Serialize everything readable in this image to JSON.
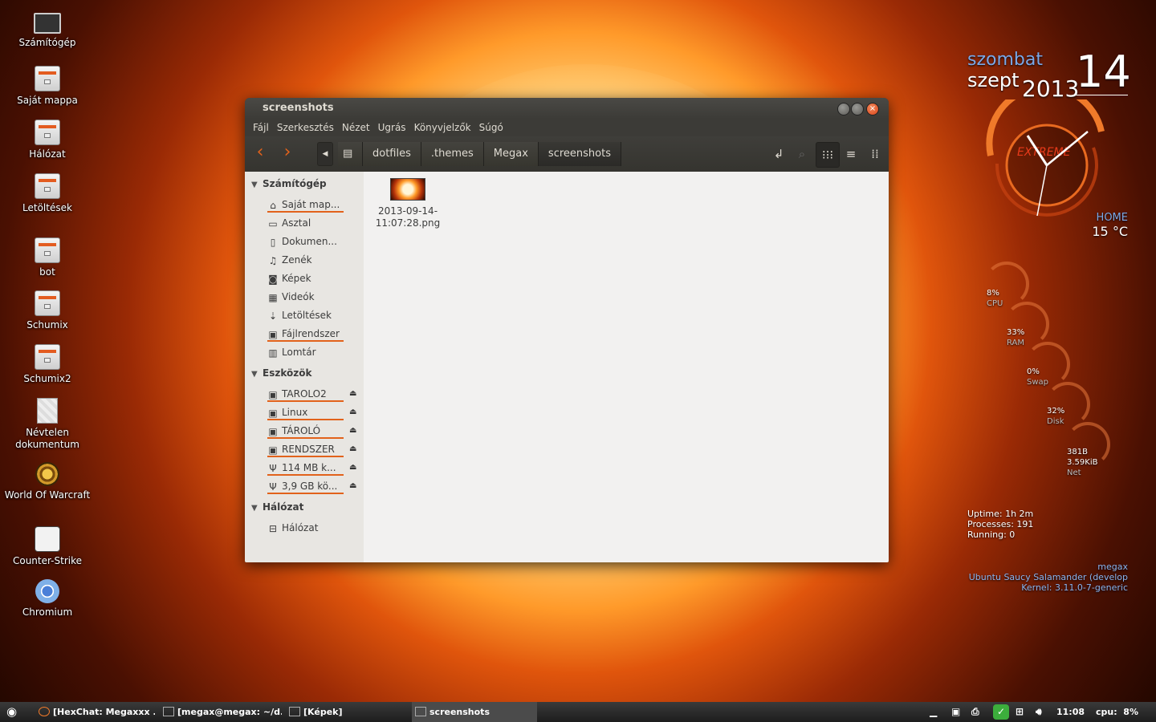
{
  "desktop": {
    "icons": [
      {
        "label": "Számítógép",
        "icon": "computer-icon"
      },
      {
        "label": "Saját mappa",
        "icon": "home-folder-icon"
      },
      {
        "label": "Hálózat",
        "icon": "network-folder-icon"
      },
      {
        "label": "Letöltések",
        "icon": "downloads-folder-icon"
      },
      {
        "label": "bot",
        "icon": "folder-icon"
      },
      {
        "label": "Schumix",
        "icon": "folder-icon"
      },
      {
        "label": "Schumix2",
        "icon": "folder-icon"
      },
      {
        "label": "Névtelen dokumentum",
        "icon": "document-icon"
      },
      {
        "label": "World Of Warcraft",
        "icon": "wow-icon"
      },
      {
        "label": "Counter-Strike",
        "icon": "counter-strike-icon"
      },
      {
        "label": "Chromium",
        "icon": "chromium-icon"
      }
    ]
  },
  "conky": {
    "day": "szombat",
    "month": "szept",
    "year": "2013",
    "date": "14",
    "location": "HOME",
    "temperature": "15 °C",
    "cpu": {
      "value": "8%",
      "label": "CPU"
    },
    "ram": {
      "value": "33%",
      "label": "RAM"
    },
    "swap": {
      "value": "0%",
      "label": "Swap"
    },
    "disk": {
      "value": "32%",
      "label": "Disk"
    },
    "net": {
      "up": "381B",
      "down": "3.59KiB",
      "label": "Net"
    },
    "uptime": "Uptime: 1h 2m",
    "processes": "Processes: 191",
    "running": "Running: 0",
    "user": "megax",
    "distro": "Ubuntu Saucy Salamander (develop",
    "kernel": "Kernel: 3.11.0-7-generic"
  },
  "window": {
    "title": "screenshots",
    "menu": [
      "Fájl",
      "Szerkesztés",
      "Nézet",
      "Ugrás",
      "Könyvjelzők",
      "Súgó"
    ],
    "breadcrumbs": [
      "dotfiles",
      ".themes",
      "Megax",
      "screenshots"
    ],
    "sidebar": {
      "computer_header": "Számítógép",
      "computer_items": [
        {
          "label": "Saját map...",
          "icon": "home-icon"
        },
        {
          "label": "Asztal",
          "icon": "desktop-icon"
        },
        {
          "label": "Dokumen...",
          "icon": "documents-icon"
        },
        {
          "label": "Zenék",
          "icon": "music-icon"
        },
        {
          "label": "Képek",
          "icon": "pictures-icon"
        },
        {
          "label": "Videók",
          "icon": "videos-icon"
        },
        {
          "label": "Letöltések",
          "icon": "downloads-icon"
        },
        {
          "label": "Fájlrendszer",
          "icon": "filesystem-icon"
        },
        {
          "label": "Lomtár",
          "icon": "trash-icon"
        }
      ],
      "devices_header": "Eszközök",
      "device_items": [
        {
          "label": "TAROLO2",
          "icon": "drive-icon"
        },
        {
          "label": "Linux",
          "icon": "drive-icon"
        },
        {
          "label": "TÁROLÓ",
          "icon": "drive-icon"
        },
        {
          "label": "RENDSZER",
          "icon": "drive-icon"
        },
        {
          "label": "114 MB k...",
          "icon": "usb-icon"
        },
        {
          "label": "3,9 GB kö...",
          "icon": "usb-icon"
        }
      ],
      "network_header": "Hálózat",
      "network_items": [
        {
          "label": "Hálózat",
          "icon": "network-icon"
        }
      ]
    },
    "files": [
      {
        "name_line1": "2013-09-14-",
        "name_line2": "11:07:28.png"
      }
    ]
  },
  "taskbar": {
    "items": [
      {
        "label": "[HexChat: Megaxxx ..."
      },
      {
        "label": "[megax@megax: ~/d..."
      },
      {
        "label": "[Képek]"
      },
      {
        "label": "screenshots"
      }
    ],
    "clock": "11:08",
    "cpu": "cpu:  8%"
  }
}
